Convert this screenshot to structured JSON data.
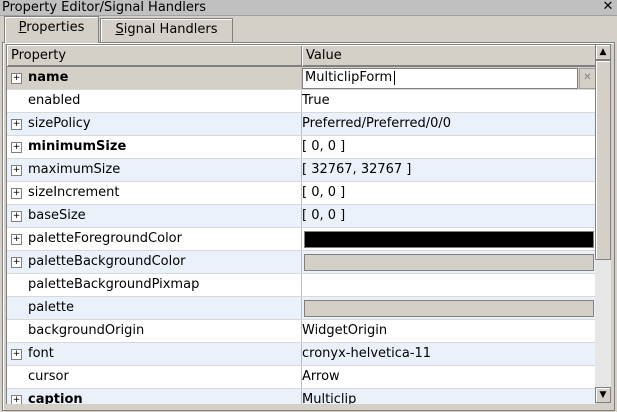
{
  "window": {
    "title": "Property Editor/Signal Handlers",
    "close_glyph": "✕"
  },
  "tabs": [
    {
      "label_prefix": "P",
      "label_rest": "roperties",
      "active": true
    },
    {
      "label_prefix": "S",
      "label_rest": "ignal Handlers",
      "active": false
    }
  ],
  "table": {
    "headers": {
      "property": "Property",
      "value": "Value"
    },
    "rows": [
      {
        "name": "name",
        "value": "MulticlipForm",
        "expandable": true,
        "bold": true,
        "editing": true
      },
      {
        "name": "enabled",
        "value": "True",
        "expandable": false,
        "bold": false
      },
      {
        "name": "sizePolicy",
        "value": "Preferred/Preferred/0/0",
        "expandable": true,
        "bold": false
      },
      {
        "name": "minimumSize",
        "value": "[ 0, 0 ]",
        "expandable": true,
        "bold": true
      },
      {
        "name": "maximumSize",
        "value": "[ 32767, 32767 ]",
        "expandable": true,
        "bold": false
      },
      {
        "name": "sizeIncrement",
        "value": "[ 0, 0 ]",
        "expandable": true,
        "bold": false
      },
      {
        "name": "baseSize",
        "value": "[ 0, 0 ]",
        "expandable": true,
        "bold": false
      },
      {
        "name": "paletteForegroundColor",
        "value": "",
        "color": "#000000",
        "expandable": true,
        "bold": false
      },
      {
        "name": "paletteBackgroundColor",
        "value": "",
        "color": "#d4d0c8",
        "expandable": true,
        "bold": false
      },
      {
        "name": "paletteBackgroundPixmap",
        "value": "",
        "expandable": false,
        "bold": false
      },
      {
        "name": "palette",
        "value": "",
        "color": "#d4d0c8",
        "expandable": false,
        "bold": false
      },
      {
        "name": "backgroundOrigin",
        "value": "WidgetOrigin",
        "expandable": false,
        "bold": false
      },
      {
        "name": "font",
        "value": "cronyx-helvetica-11",
        "expandable": true,
        "bold": false
      },
      {
        "name": "cursor",
        "value": "Arrow",
        "expandable": false,
        "bold": false
      },
      {
        "name": "caption",
        "value": "Multiclip",
        "expandable": true,
        "bold": true
      }
    ]
  }
}
